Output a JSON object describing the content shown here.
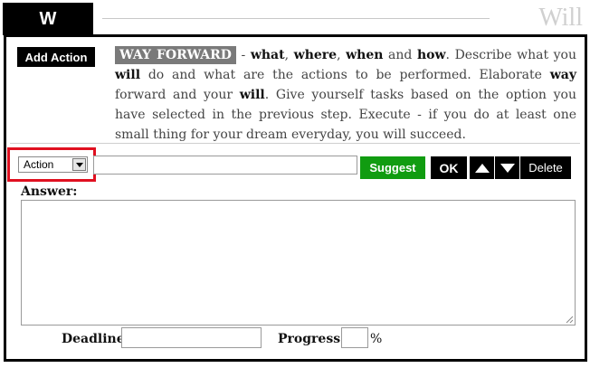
{
  "header": {
    "tab_label": "W",
    "step_title": "Will"
  },
  "toolbar": {
    "add_action_label": "Add Action",
    "suggest_label": "Suggest",
    "ok_label": "OK",
    "delete_label": "Delete",
    "up_icon": "triangle-up-icon",
    "down_icon": "triangle-down-icon"
  },
  "description": {
    "badge": "WAY FORWARD",
    "t1": " - ",
    "b1": "what",
    "t2": ", ",
    "b2": "where",
    "t3": ", ",
    "b3": "when",
    "t4": " and ",
    "b4": "how",
    "t5": ". Describe what you ",
    "b5": "will",
    "t6": " do and what are the actions to be performed. Elaborate ",
    "b6": "way",
    "t7": " forward and your ",
    "b7": "will",
    "t8": ". Give yourself tasks based on the option you have selected in the previous step. Execute - if you do at least one small thing for your dream everyday, you will succeed."
  },
  "form": {
    "type_select_value": "Action",
    "text_input_value": "",
    "answer_label": "Answer:",
    "answer_value": "",
    "deadline_label": "Deadline:",
    "deadline_value": "",
    "progress_label": "Progress:",
    "progress_value": "",
    "percent_sign": "%"
  },
  "colors": {
    "highlight_border": "#e01020",
    "suggest_button": "#119c11",
    "badge_background": "#7a7a7a"
  }
}
